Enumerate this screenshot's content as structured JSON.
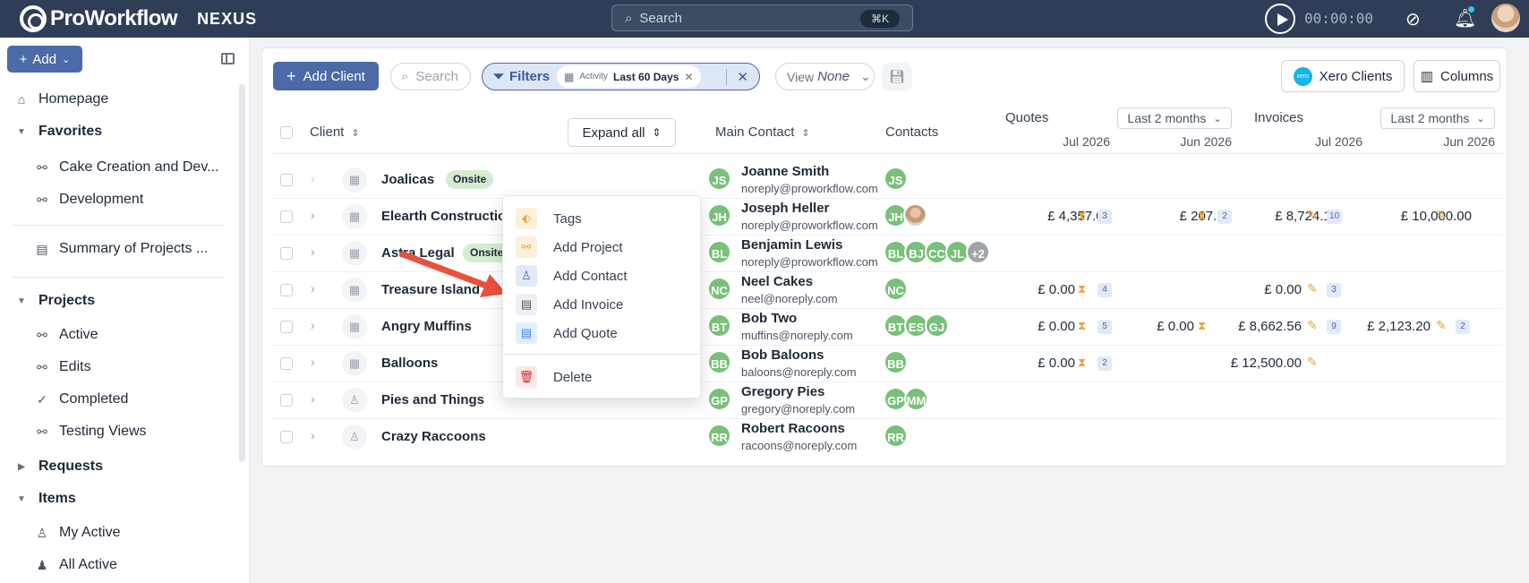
{
  "topbar": {
    "brand": "ProWorkflow",
    "product": "NEXUS",
    "search_placeholder": "Search",
    "search_shortcut": "⌘K",
    "timer": "00:00:00"
  },
  "sidebar": {
    "add_label": "Add",
    "items": [
      {
        "label": "Homepage",
        "icon": "home-icon"
      },
      {
        "label": "Favorites",
        "type": "section"
      },
      {
        "label": "Cake Creation and Dev...",
        "icon": "project-icon"
      },
      {
        "label": "Development",
        "icon": "project-icon"
      },
      {
        "label": "Summary of Projects ...",
        "icon": "document-icon"
      },
      {
        "label": "Projects",
        "type": "section"
      },
      {
        "label": "Active",
        "icon": "project-icon"
      },
      {
        "label": "Edits",
        "icon": "project-icon"
      },
      {
        "label": "Completed",
        "icon": "check-circle-icon"
      },
      {
        "label": "Testing Views",
        "icon": "project-icon"
      },
      {
        "label": "Requests",
        "type": "section"
      },
      {
        "label": "Items",
        "type": "section"
      },
      {
        "label": "My Active",
        "icon": "user-icon"
      },
      {
        "label": "All Active",
        "icon": "users-icon"
      }
    ]
  },
  "toolbar": {
    "add_client": "Add Client",
    "search_placeholder": "Search",
    "filters_label": "Filters",
    "filter_field": "Activity",
    "filter_value": "Last 60 Days",
    "view_label": "View",
    "view_value": "None",
    "xero_logo": "xero",
    "xero_label": "Xero Clients",
    "columns_label": "Columns"
  },
  "table": {
    "headers": {
      "client": "Client",
      "expand_all": "Expand all",
      "main_contact": "Main Contact",
      "contacts": "Contacts",
      "quotes": "Quotes",
      "quotes_period": "Last 2 months",
      "invoices": "Invoices",
      "invoices_period": "Last 2 months",
      "month_a": "Jul 2026",
      "month_b": "Jun 2026"
    },
    "rows": [
      {
        "name": "Joalicas",
        "badge": "Onsite",
        "mc_initials": "JS",
        "mc_name": "Joanne Smith",
        "mc_email": "noreply@proworkflow.com",
        "contacts": [
          "JS"
        ]
      },
      {
        "name": "Elearth Construction",
        "mc_initials": "JH",
        "mc_name": "Joseph Heller",
        "mc_email": "noreply@proworkflow.com",
        "contacts": [
          "JH"
        ],
        "q_jul": "£ 4,357.00",
        "q_jul_n": "3",
        "q_jun": "£ 207.00",
        "q_jun_n": "2",
        "i_jul": "£ 8,724.11",
        "i_jul_n": "10",
        "i_jun": "£ 10,000.00"
      },
      {
        "name": "Astra Legal",
        "badge": "Onsite",
        "mc_initials": "BL",
        "mc_name": "Benjamin Lewis",
        "mc_email": "noreply@proworkflow.com",
        "contacts": [
          "BL",
          "BJ",
          "CC",
          "JL"
        ],
        "contacts_more": "+2"
      },
      {
        "name": "Treasure Island",
        "mc_initials": "NC",
        "mc_name": "Neel Cakes",
        "mc_email": "neel@noreply.com",
        "contacts": [
          "NC"
        ],
        "q_jul": "£ 0.00",
        "q_jul_n": "4",
        "i_jul": "£ 0.00",
        "i_jul_n": "3"
      },
      {
        "name": "Angry Muffins",
        "mc_initials": "BT",
        "mc_name": "Bob Two",
        "mc_email": "muffins@noreply.com",
        "contacts": [
          "BT",
          "ES",
          "GJ"
        ],
        "q_jul": "£ 0.00",
        "q_jul_n": "5",
        "q_jun": "£ 0.00",
        "i_jul": "£ 8,662.56",
        "i_jul_n": "9",
        "i_jun": "£ 2,123.20",
        "i_jun_n": "2"
      },
      {
        "name": "Balloons",
        "mc_initials": "BB",
        "mc_name": "Bob Baloons",
        "mc_email": "baloons@noreply.com",
        "contacts": [
          "BB"
        ],
        "q_jul": "£ 0.00",
        "q_jul_n": "2",
        "i_jul": "£ 12,500.00"
      },
      {
        "name": "Pies and Things",
        "mc_initials": "GP",
        "mc_name": "Gregory Pies",
        "mc_email": "gregory@noreply.com",
        "contacts": [
          "GP",
          "MM"
        ]
      },
      {
        "name": "Crazy Raccoons",
        "mc_initials": "RR",
        "mc_name": "Robert Racoons",
        "mc_email": "racoons@noreply.com",
        "contacts": [
          "RR"
        ]
      }
    ]
  },
  "context_menu": {
    "items": [
      "Tags",
      "Add Project",
      "Add Contact",
      "Add Invoice",
      "Add Quote"
    ],
    "delete": "Delete"
  },
  "colors": {
    "topbar": "#2f3d56",
    "primary": "#4b6aa7",
    "avatar_green": "#79c07a",
    "accent_orange": "#e8a33d",
    "delete_red": "#dc2626"
  }
}
